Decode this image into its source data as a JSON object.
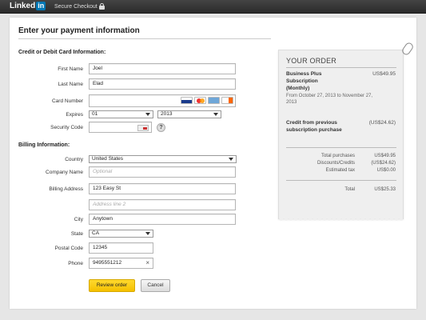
{
  "header": {
    "logo_text": "Linked",
    "logo_in": "in",
    "secure_label": "Secure Checkout"
  },
  "page": {
    "title": "Enter your payment information"
  },
  "card_section": {
    "heading": "Credit or Debit Card Information:",
    "first_name_label": "First Name",
    "first_name_value": "Joel",
    "last_name_label": "Last Name",
    "last_name_value": "Elad",
    "card_number_label": "Card Number",
    "card_number_value": "",
    "expires_label": "Expires",
    "expires_month": "01",
    "expires_year": "2013",
    "security_code_label": "Security Code",
    "security_code_value": "",
    "help_glyph": "?"
  },
  "billing_section": {
    "heading": "Billing Information:",
    "country_label": "Country",
    "country_value": "United States",
    "company_label": "Company Name",
    "company_placeholder": "Optional",
    "address_label": "Billing Address",
    "address_value": "123 Easy St",
    "address2_placeholder": "Address line 2",
    "city_label": "City",
    "city_value": "Anytown",
    "state_label": "State",
    "state_value": "CA",
    "postal_label": "Postal Code",
    "postal_value": "12345",
    "phone_label": "Phone",
    "phone_value": "9495551212",
    "clear_glyph": "×"
  },
  "actions": {
    "review_label": "Review order",
    "cancel_label": "Cancel"
  },
  "order": {
    "title": "YOUR ORDER",
    "item_name": "Business Plus Subscription (Monthly)",
    "item_price": "US$49.95",
    "item_period": "From October 27, 2013 to November 27, 2013",
    "credit_name": "Credit from previous subscription purchase",
    "credit_price": "(US$24.62)",
    "total_purchases_label": "Total purchases",
    "total_purchases_value": "US$49.95",
    "discounts_label": "Discounts/Credits",
    "discounts_value": "(US$24.62)",
    "tax_label": "Estimated tax",
    "tax_value": "US$0.00",
    "total_label": "Total",
    "total_value": "US$25.33"
  },
  "icons": [
    "lock-icon",
    "visa-icon",
    "mastercard-icon",
    "amex-icon",
    "discover-icon",
    "cvv-card-icon",
    "help-icon",
    "clear-icon",
    "paperclip-icon"
  ],
  "colors": {
    "brand_blue": "#0077b5",
    "primary_button": "#f5c000",
    "topbar": "#333333"
  }
}
